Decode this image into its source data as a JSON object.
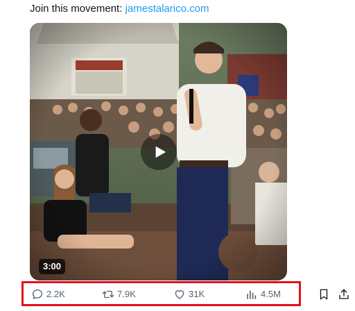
{
  "tweet": {
    "text_prefix": "Join this movement: ",
    "link_text": "jamestalarico.com"
  },
  "video": {
    "duration": "3:00",
    "play_icon": "play-icon"
  },
  "actions": {
    "reply": {
      "icon": "reply-icon",
      "count": "2.2K"
    },
    "repost": {
      "icon": "repost-icon",
      "count": "7.9K"
    },
    "like": {
      "icon": "heart-icon",
      "count": "31K"
    },
    "views": {
      "icon": "bar-chart-icon",
      "count": "4.5M"
    },
    "bookmark": {
      "icon": "bookmark-icon"
    },
    "share": {
      "icon": "share-icon"
    }
  },
  "colors": {
    "link": "#1d9bf0",
    "icon_gray": "#536471",
    "highlight_border": "#e3101c"
  }
}
